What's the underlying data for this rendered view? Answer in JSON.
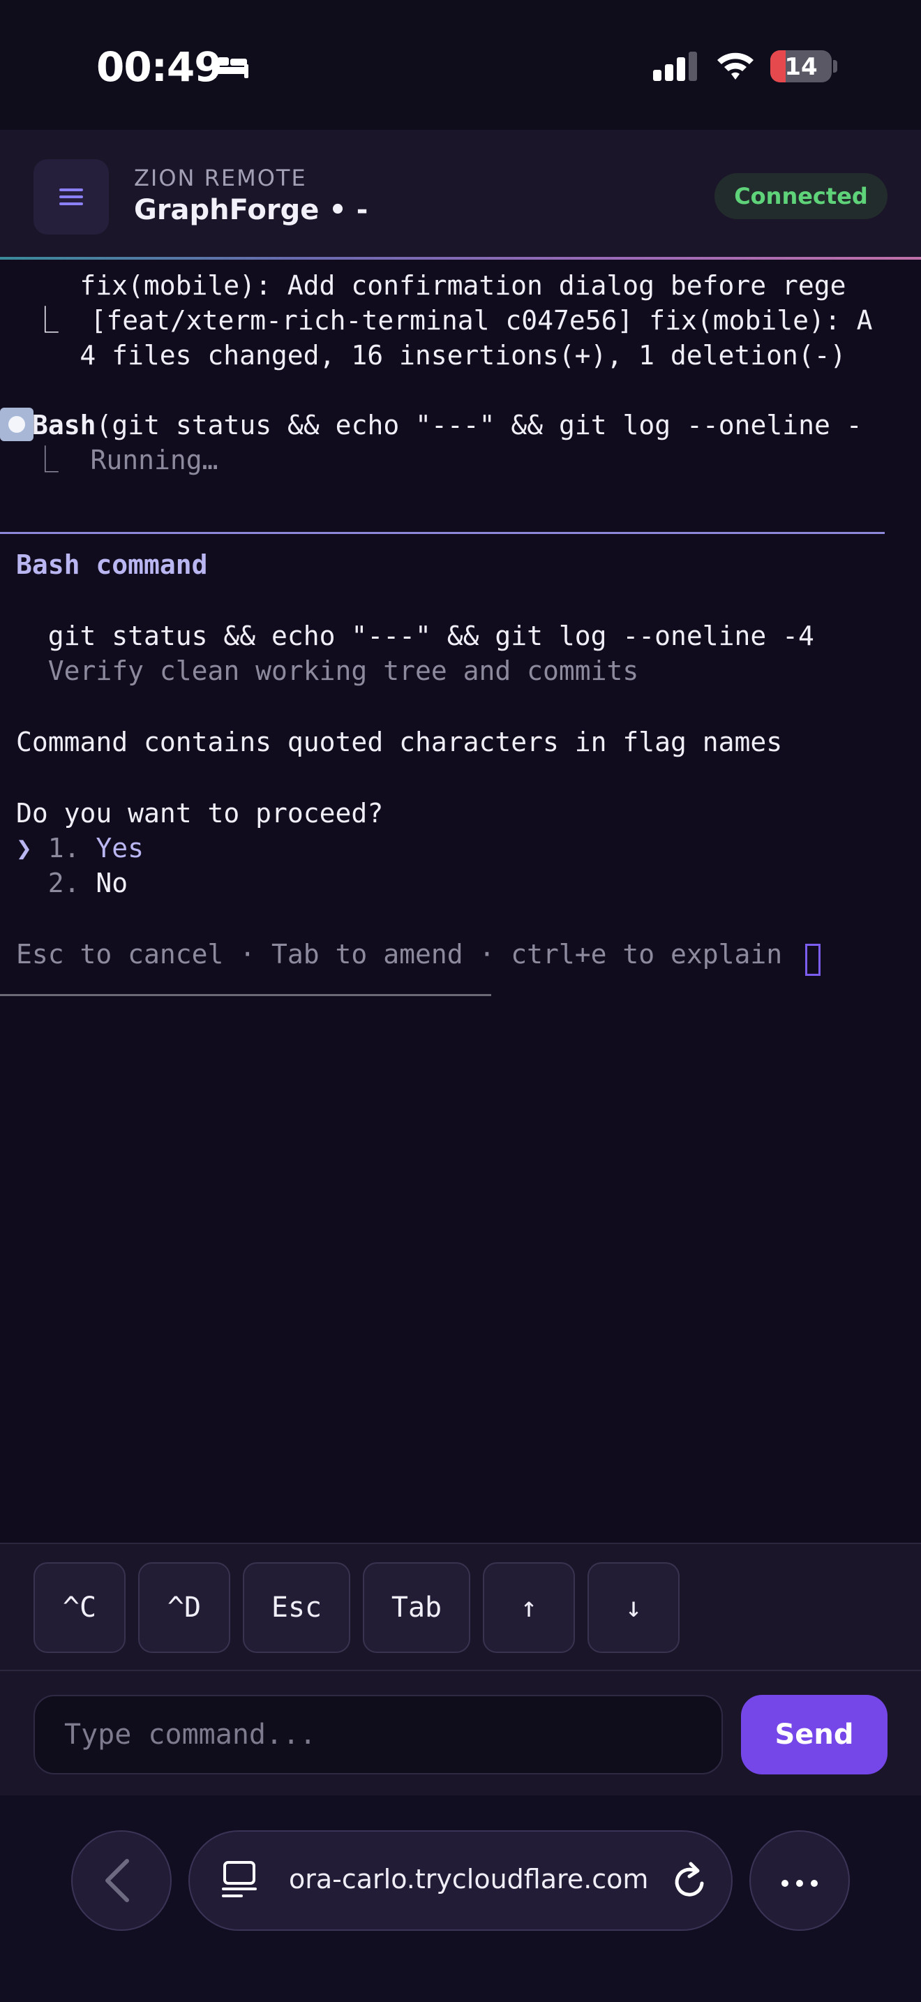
{
  "status_bar": {
    "time": "00:49",
    "battery": "14",
    "battery_level": 0.14,
    "status_red": "#e5484d"
  },
  "header": {
    "eyebrow": "ZION REMOTE",
    "title": "GraphForge • -",
    "status": "Connected",
    "status_color": "#5fd37a"
  },
  "terminal": {
    "lines": [
      "     fix(mobile): Add confirmation dialog before rege",
      "  ⎿  [feat/xterm-rich-terminal c047e56] fix(mobile): A",
      "     4 files changed, 16 insertions(+), 1 deletion(-)"
    ],
    "tool_name": "Bash",
    "tool_args": "(git status && echo \"---\" && git log --oneline -",
    "tool_status": "  ⎿  Running…",
    "dialog": {
      "title": "Bash command",
      "command": "  git status && echo \"---\" && git log --oneline -4",
      "description": "  Verify clean working tree and commits",
      "warning": "Command contains quoted characters in flag names",
      "question": "Do you want to proceed?",
      "pointer": "❯ ",
      "option_1_num": "1. ",
      "option_1_label": "Yes",
      "option_2_num": "  2. ",
      "option_2_label": "No",
      "hint": "Esc to cancel · Tab to amend · ctrl+e to explain"
    }
  },
  "keys": [
    "^C",
    "^D",
    "Esc",
    "Tab",
    "↑",
    "↓"
  ],
  "input": {
    "placeholder": "Type command...",
    "send_label": "Send"
  },
  "browser": {
    "url": "ora-carlo.trycloudflare.com"
  },
  "colors": {
    "accent": "#7546e8",
    "background": "#100c1e"
  },
  "icons": [
    "bed-icon",
    "signal-icon",
    "wifi-icon",
    "menu-icon",
    "back-icon",
    "tabs-icon",
    "reload-icon",
    "more-icon"
  ]
}
